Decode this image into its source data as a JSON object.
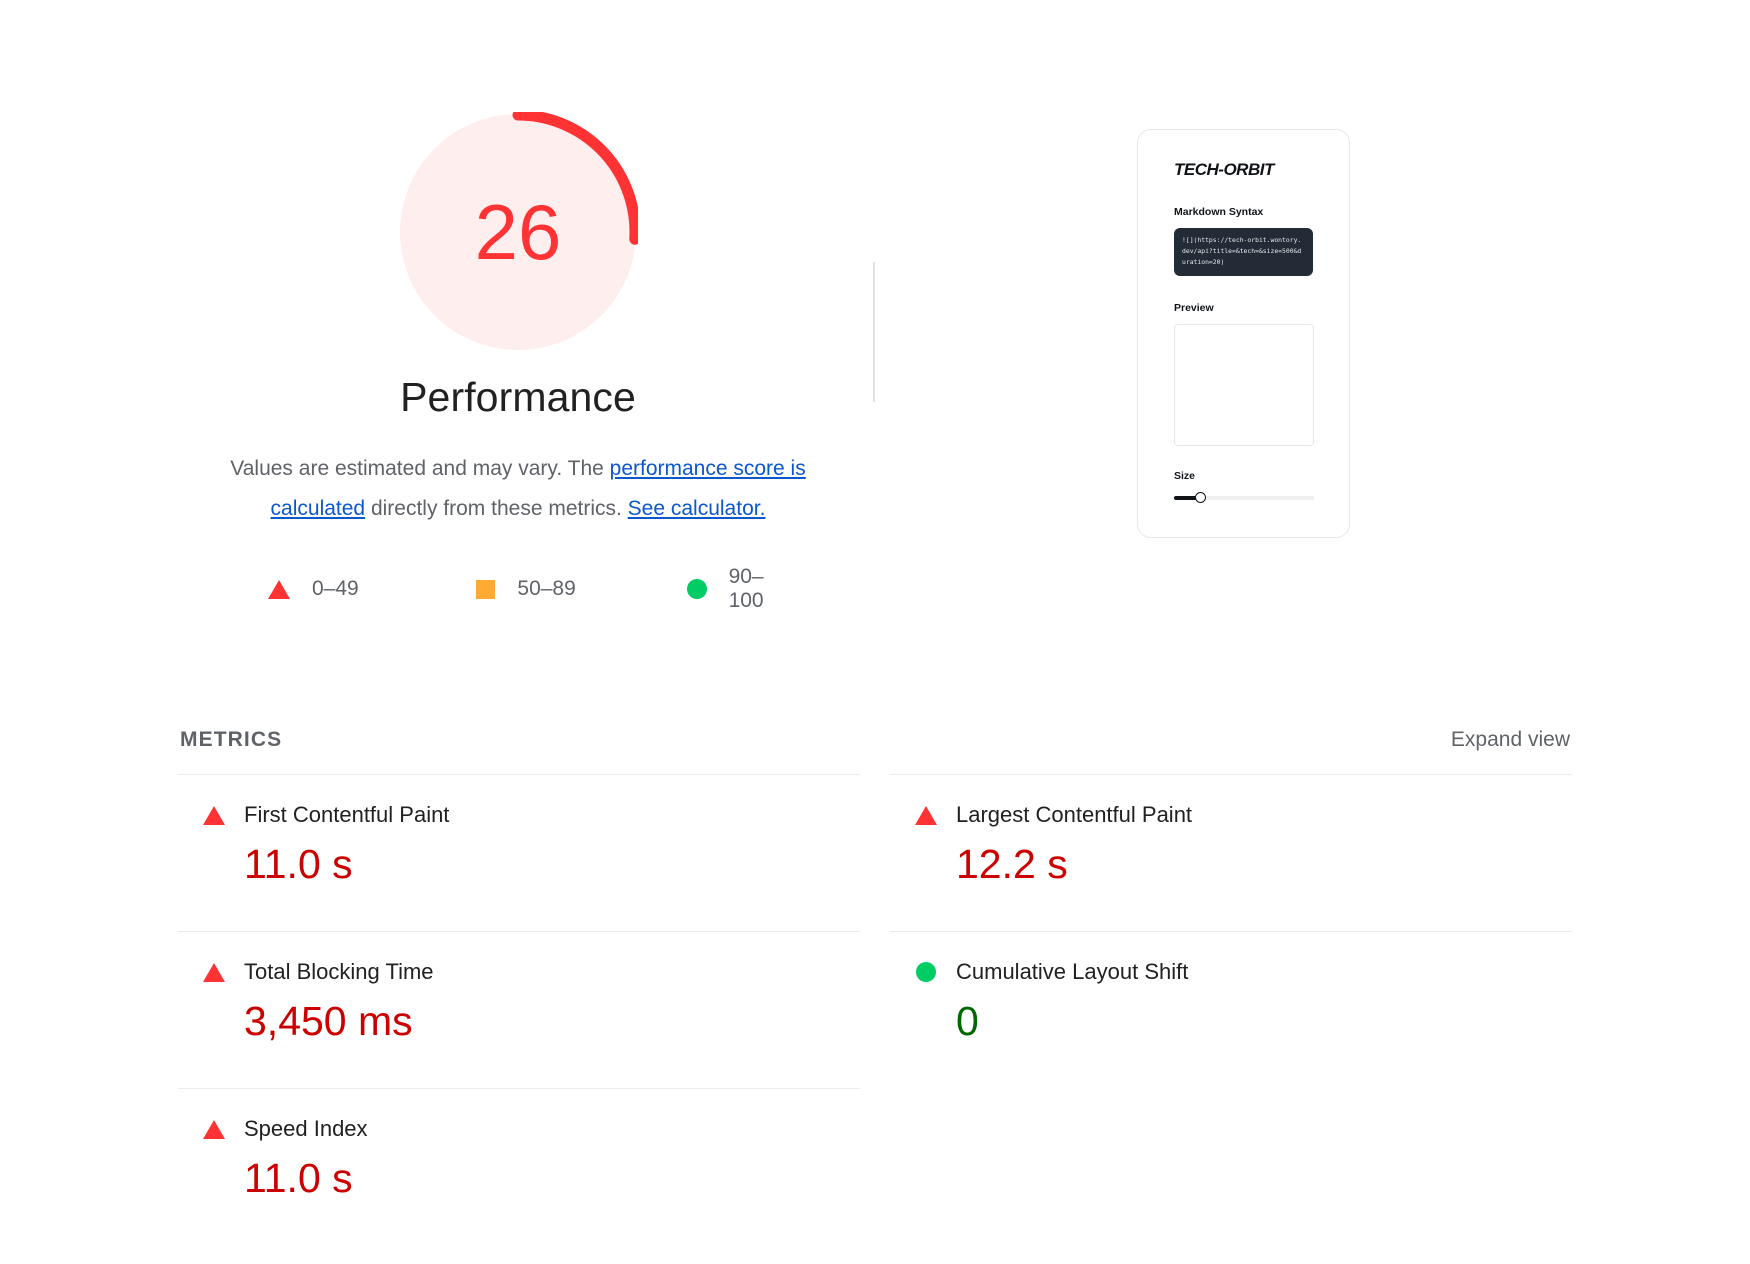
{
  "gauge": {
    "score": "26",
    "max": 100,
    "title": "Performance",
    "color": "#ff3333",
    "track_color": "#ffeeee"
  },
  "description": {
    "part1": "Values are estimated and may vary. The ",
    "link1": "performance score is calculated",
    "part2": " directly from these metrics. ",
    "link2": "See calculator."
  },
  "legend": {
    "items": [
      {
        "icon": "triangle-icon",
        "label": "0–49",
        "color": "#ff3333"
      },
      {
        "icon": "square-icon",
        "label": "50–89",
        "color": "#ffaa33"
      },
      {
        "icon": "circle-icon",
        "label": "90–100",
        "color": "#00cc66"
      }
    ]
  },
  "preview_card": {
    "brand": "TECH-ORBIT",
    "markdown_label": "Markdown Syntax",
    "code": "![](https://tech-orbit.wontory.dev/api?title=&tech=&size=500&duration=20)",
    "preview_label": "Preview",
    "size_label": "Size"
  },
  "metrics_section": {
    "title": "METRICS",
    "expand_label": "Expand view",
    "items": [
      {
        "icon": "triangle-icon",
        "status": "fail",
        "name": "First Contentful Paint",
        "value": "11.0 s"
      },
      {
        "icon": "triangle-icon",
        "status": "fail",
        "name": "Largest Contentful Paint",
        "value": "12.2 s"
      },
      {
        "icon": "triangle-icon",
        "status": "fail",
        "name": "Total Blocking Time",
        "value": "3,450 ms"
      },
      {
        "icon": "circle-icon",
        "status": "pass",
        "name": "Cumulative Layout Shift",
        "value": "0"
      },
      {
        "icon": "triangle-icon",
        "status": "fail",
        "name": "Speed Index",
        "value": "11.0 s"
      }
    ]
  }
}
